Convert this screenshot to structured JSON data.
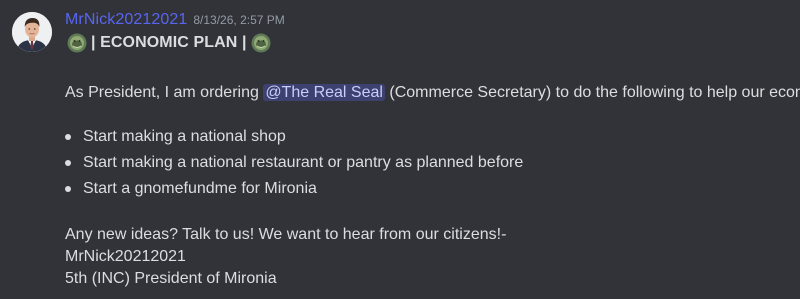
{
  "author": {
    "username": "MrNick20212021",
    "timestamp": "8/13/26, 2:57 PM",
    "name_color": "#5865f2"
  },
  "title": {
    "left_emoji": "seal-emoji",
    "text": "| ECONOMIC PLAN |",
    "right_emoji": "seal-emoji"
  },
  "intro": {
    "before_mention": "As President, I am ordering ",
    "mention": "@The Real Seal",
    "after_mention": " (Commerce Secretary) to do the following to help our economy:"
  },
  "bullets": [
    "Start making a national shop",
    "Start making a national restaurant or pantry as planned before",
    "Start a gnomefundme for Mironia"
  ],
  "closing": {
    "line1": "Any new ideas? Talk to us! We want to hear from our citizens!-",
    "line2": "MrNick20212021",
    "line3": "5th (INC) President of Mironia"
  },
  "colors": {
    "background": "#313338",
    "text": "#dbdee1",
    "timestamp": "#949ba4",
    "mention_bg": "#3c4270",
    "mention_text": "#c9cdfb"
  }
}
